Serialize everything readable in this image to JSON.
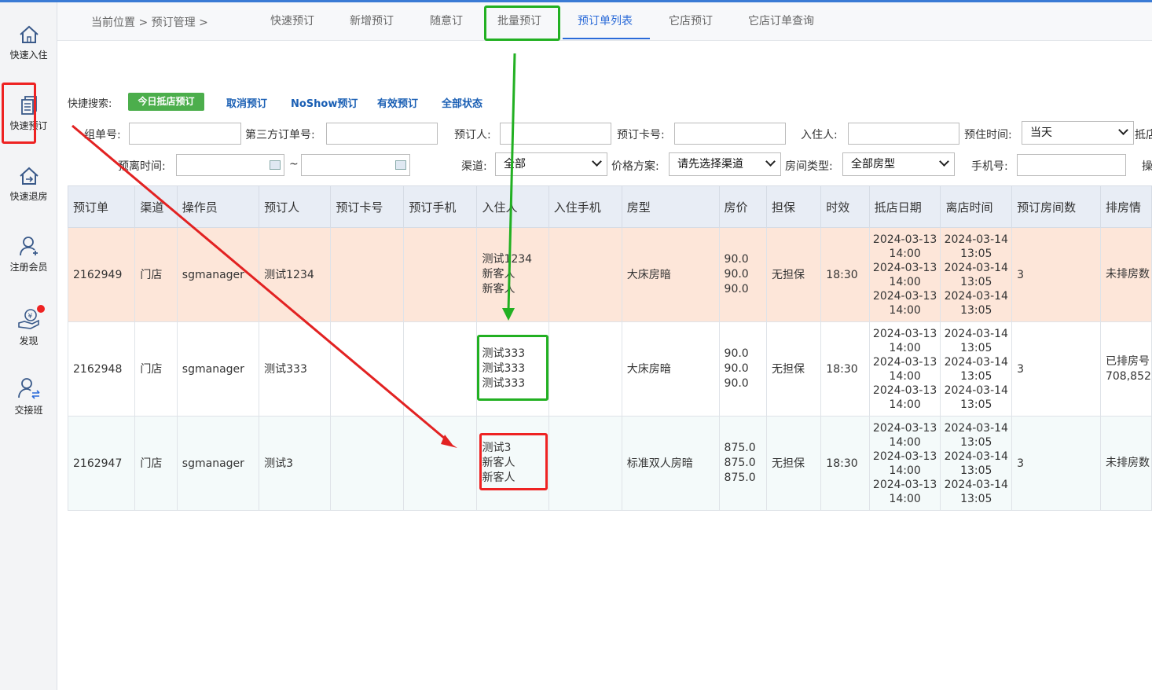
{
  "sidebar": {
    "items": [
      {
        "label": "快速入住"
      },
      {
        "label": "快速预订"
      },
      {
        "label": "快速退房"
      },
      {
        "label": "注册会员"
      },
      {
        "label": "发现"
      },
      {
        "label": "交接班"
      }
    ]
  },
  "breadcrumb": {
    "text": "当前位置 > 预订管理 >"
  },
  "tabs": [
    {
      "label": "快速预订"
    },
    {
      "label": "新增预订"
    },
    {
      "label": "随意订"
    },
    {
      "label": "批量预订"
    },
    {
      "label": "预订单列表",
      "active": true
    },
    {
      "label": "它店预订"
    },
    {
      "label": "它店订单查询"
    }
  ],
  "quick_search": {
    "label": "快捷搜索:",
    "options": [
      "今日抵店预订",
      "取消预订",
      "NoShow预订",
      "有效预订",
      "全部状态"
    ]
  },
  "filters": {
    "group_no": "组单号:",
    "third_party_no": "第三方订单号:",
    "booker": "预订人:",
    "booking_card": "预订卡号:",
    "guest": "入住人:",
    "stay_time": "预住时间:",
    "stay_time_value": "当天",
    "arrive_cut": "抵店",
    "depart_time": "预离时间:",
    "tilde": "~",
    "channel": "渠道:",
    "channel_value": "全部",
    "price_plan": "价格方案:",
    "price_plan_value": "请先选择渠道",
    "room_type": "房间类型:",
    "room_type_value": "全部房型",
    "phone": "手机号:",
    "op_cut": "操"
  },
  "table": {
    "headers": [
      "预订单",
      "渠道",
      "操作员",
      "预订人",
      "预订卡号",
      "预订手机",
      "入住人",
      "入住手机",
      "房型",
      "房价",
      "担保",
      "时效",
      "抵店日期",
      "离店时间",
      "预订房间数",
      "排房情"
    ],
    "rows": [
      {
        "order": "2162949",
        "channel": "门店",
        "operator": "sgmanager",
        "booker": "测试1234",
        "card": "",
        "booker_phone": "",
        "guests": [
          "测试1234",
          "新客人",
          "新客人"
        ],
        "guest_phone": "",
        "room_type": "大床房暗",
        "prices": [
          "90.0",
          "90.0",
          "90.0"
        ],
        "guarantee": "无担保",
        "validity": "18:30",
        "arrive": [
          "2024-03-13",
          "14:00",
          "2024-03-13",
          "14:00",
          "2024-03-13",
          "14:00"
        ],
        "depart": [
          "2024-03-14",
          "13:05",
          "2024-03-14",
          "13:05",
          "2024-03-14",
          "13:05"
        ],
        "rooms": "3",
        "assign": [
          "未排房数"
        ]
      },
      {
        "order": "2162948",
        "channel": "门店",
        "operator": "sgmanager",
        "booker": "测试333",
        "card": "",
        "booker_phone": "",
        "guests": [
          "测试333",
          "测试333",
          "测试333"
        ],
        "guest_phone": "",
        "room_type": "大床房暗",
        "prices": [
          "90.0",
          "90.0",
          "90.0"
        ],
        "guarantee": "无担保",
        "validity": "18:30",
        "arrive": [
          "2024-03-13",
          "14:00",
          "2024-03-13",
          "14:00",
          "2024-03-13",
          "14:00"
        ],
        "depart": [
          "2024-03-14",
          "13:05",
          "2024-03-14",
          "13:05",
          "2024-03-14",
          "13:05"
        ],
        "rooms": "3",
        "assign": [
          "已排房号",
          "708,852"
        ]
      },
      {
        "order": "2162947",
        "channel": "门店",
        "operator": "sgmanager",
        "booker": "测试3",
        "card": "",
        "booker_phone": "",
        "guests": [
          "测试3",
          "新客人",
          "新客人"
        ],
        "guest_phone": "",
        "room_type": "标准双人房暗",
        "prices": [
          "875.0",
          "875.0",
          "875.0"
        ],
        "guarantee": "无担保",
        "validity": "18:30",
        "arrive": [
          "2024-03-13",
          "14:00",
          "2024-03-13",
          "14:00",
          "2024-03-13",
          "14:00"
        ],
        "depart": [
          "2024-03-14",
          "13:05",
          "2024-03-14",
          "13:05",
          "2024-03-14",
          "13:05"
        ],
        "rooms": "3",
        "assign": [
          "未排房数"
        ]
      }
    ]
  },
  "colors": {
    "annotation_green": "#22b022",
    "annotation_red": "#e22222",
    "accent_blue": "#2a6ad8",
    "row_highlight": "#fde6d9"
  },
  "icons": [
    "home-icon",
    "booking-doc-icon",
    "checkout-house-icon",
    "add-member-icon",
    "discover-coin-hand-icon",
    "shift-handover-icon",
    "calendar-icon",
    "chevron-down-icon"
  ]
}
